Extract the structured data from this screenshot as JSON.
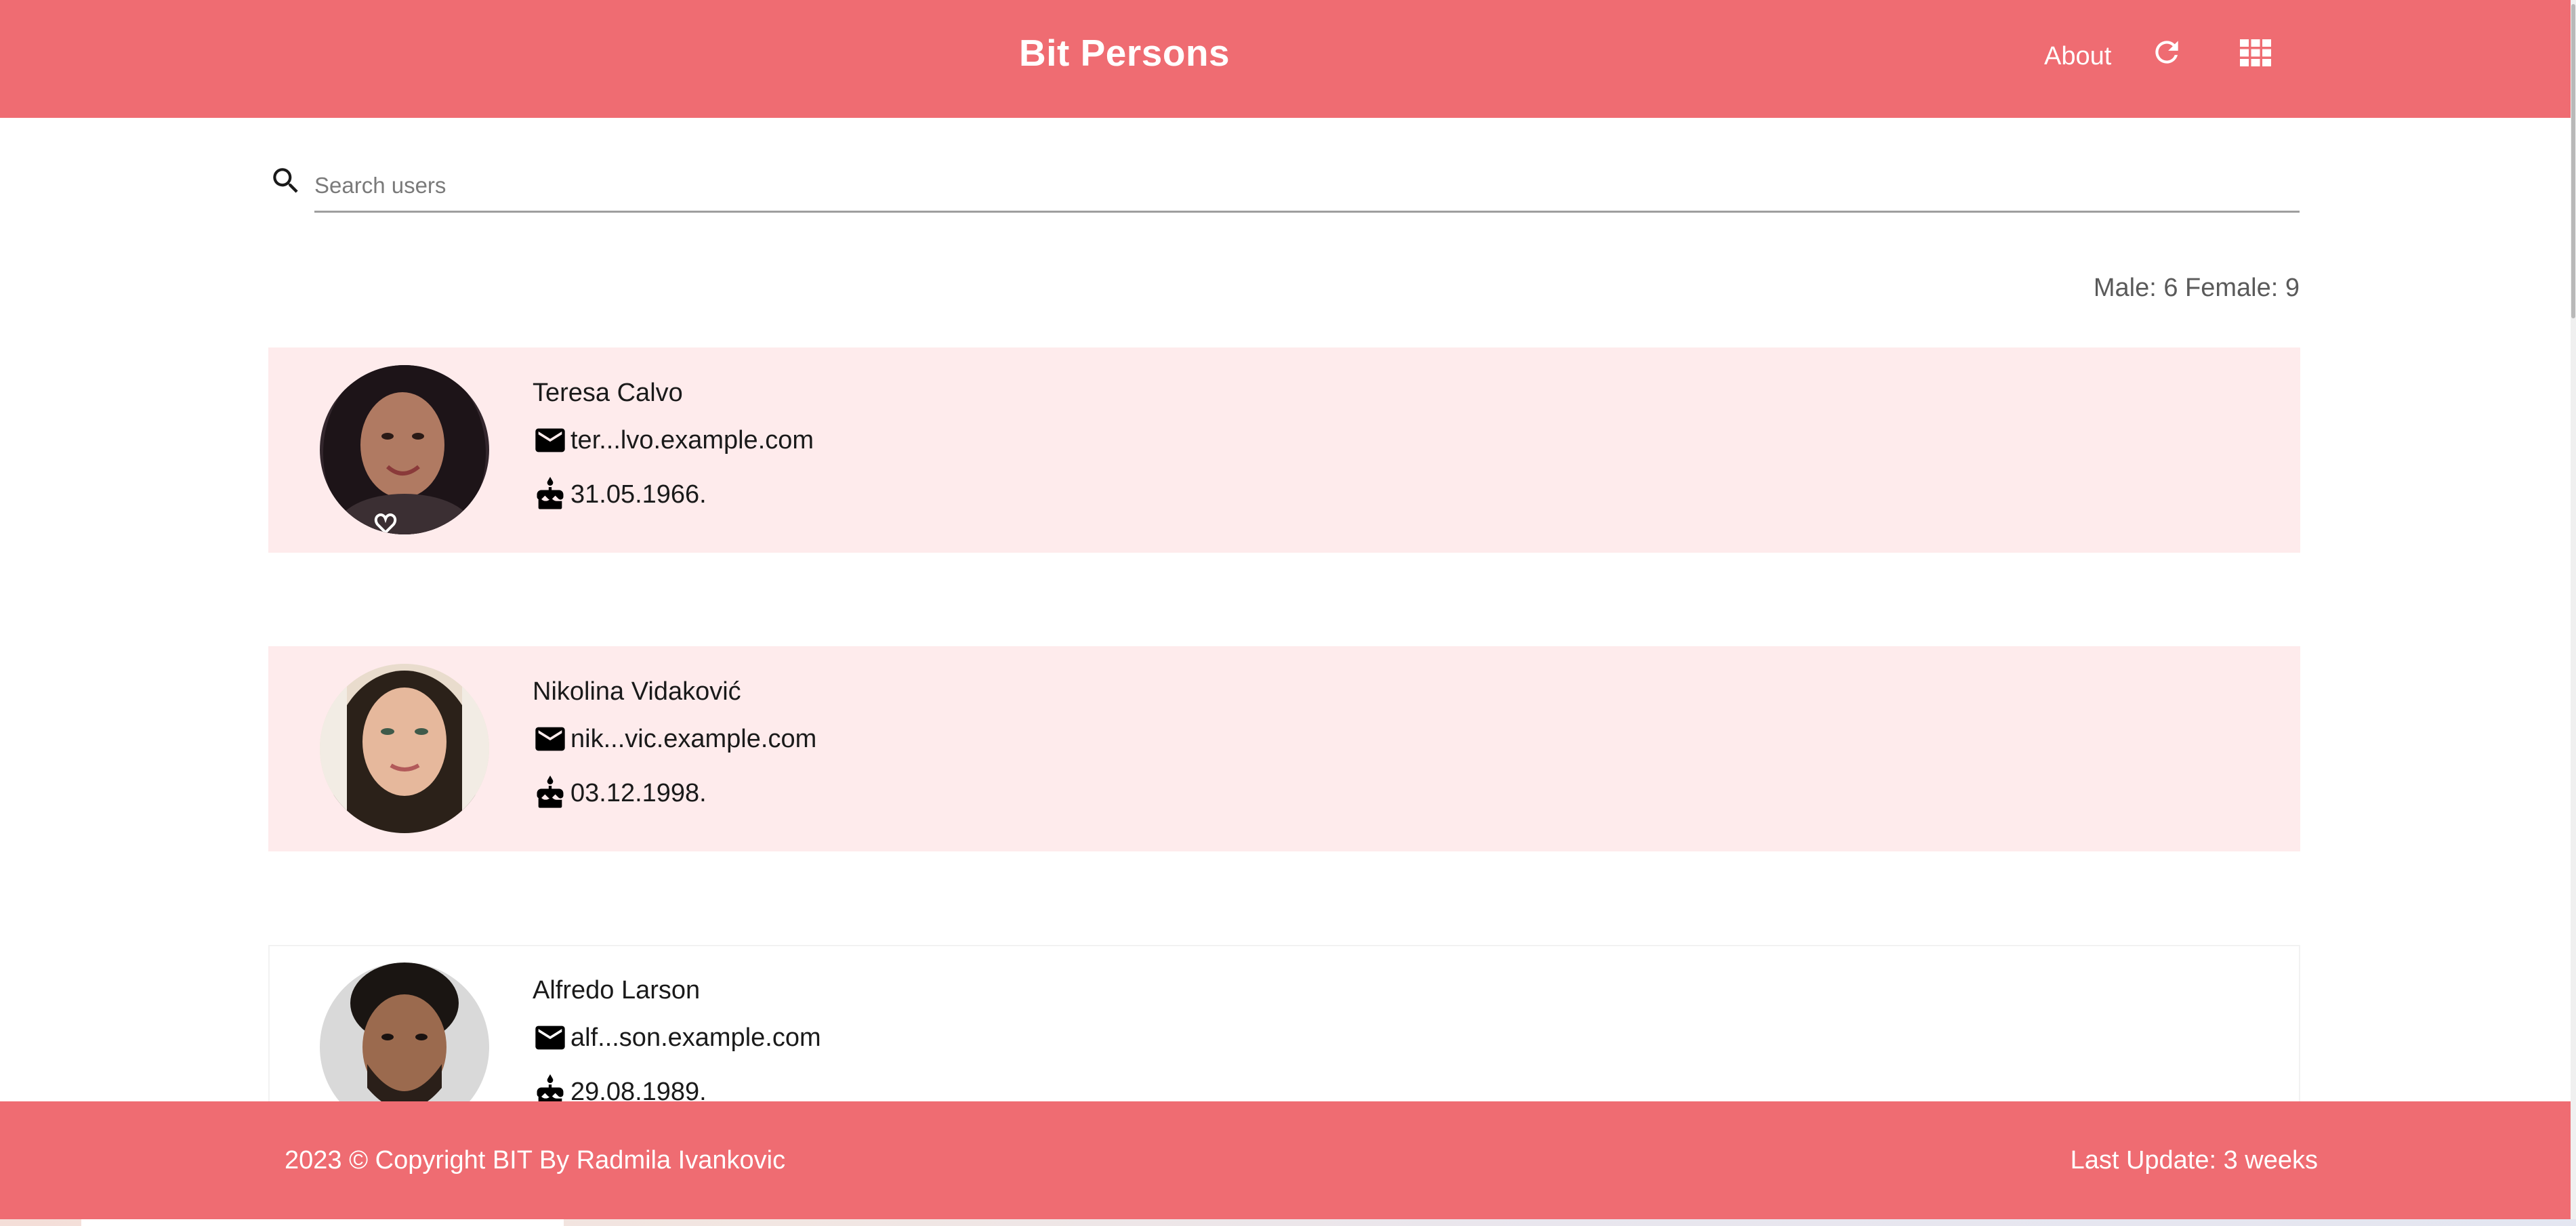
{
  "header": {
    "title": "Bit Persons",
    "about_label": "About",
    "refresh_icon": "refresh-icon",
    "grid_icon": "grid-view-icon"
  },
  "search": {
    "placeholder": "Search users",
    "value": ""
  },
  "stats": {
    "text": "Male: 6 Female: 9"
  },
  "users": [
    {
      "name": "Teresa Calvo",
      "email": "ter...lvo.example.com",
      "birthday": "31.05.1966.",
      "gender": "female"
    },
    {
      "name": "Nikolina Vidaković",
      "email": "nik...vic.example.com",
      "birthday": "03.12.1998.",
      "gender": "female"
    },
    {
      "name": "Alfredo Larson",
      "email": "alf...son.example.com",
      "birthday": "29.08.1989.",
      "gender": "male"
    }
  ],
  "footer": {
    "copyright": "2023 © Copyright BIT By Radmila Ivankovic",
    "last_update": "Last Update: 3 weeks"
  },
  "colors": {
    "brand": "#ef6c72",
    "female_card": "#feebec",
    "male_card": "#ffffff"
  }
}
